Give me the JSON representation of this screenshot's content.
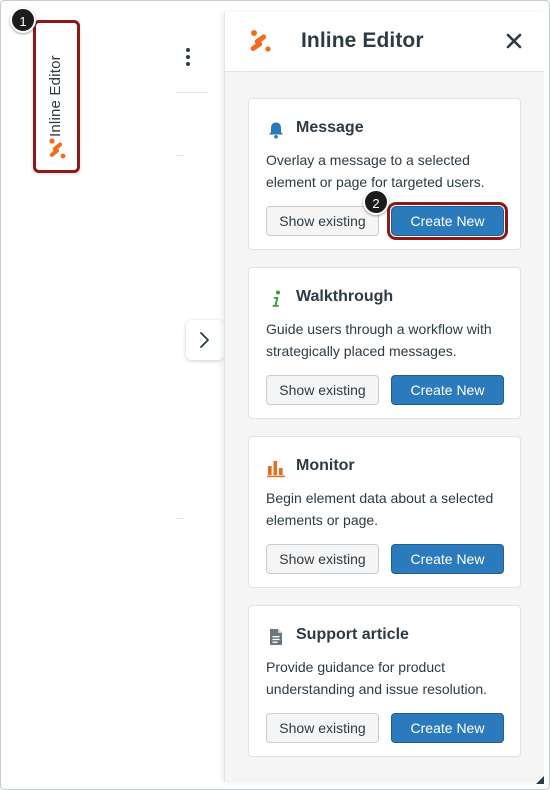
{
  "side_tab": {
    "label": "Inline Editor"
  },
  "callouts": {
    "one": "1",
    "two": "2"
  },
  "panel": {
    "title": "Inline Editor",
    "close_icon": "close-icon"
  },
  "cards": [
    {
      "title": "Message",
      "icon": "bell-icon",
      "description": "Overlay a message to a selected element or page for targeted users.",
      "show_label": "Show existing",
      "create_label": "Create New"
    },
    {
      "title": "Walkthrough",
      "icon": "info-icon",
      "description": "Guide users through a workflow with strategically placed messages.",
      "show_label": "Show existing",
      "create_label": "Create New"
    },
    {
      "title": "Monitor",
      "icon": "bar-chart-icon",
      "description": "Begin element data about a selected elements or page.",
      "show_label": "Show existing",
      "create_label": "Create New"
    },
    {
      "title": "Support article",
      "icon": "document-icon",
      "description": "Provide guidance for product understanding and issue resolution.",
      "show_label": "Show existing",
      "create_label": "Create New"
    }
  ],
  "colors": {
    "primary": "#2b7abc",
    "highlight": "#8b1a1a",
    "brand_orange": "#f26c22",
    "message_icon": "#2b7abc",
    "walkthrough_icon": "#3a9b3a",
    "monitor_icon": "#e0701e",
    "document_icon": "#6b7780"
  }
}
